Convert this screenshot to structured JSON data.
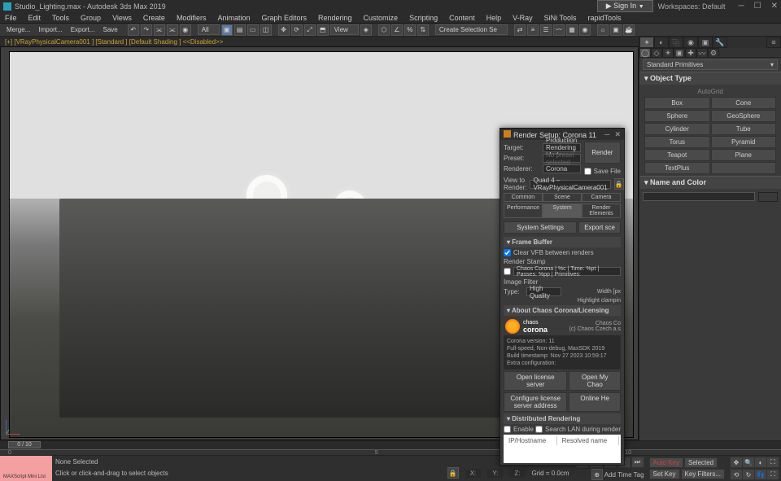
{
  "title": "Studio_Lighting.max - Autodesk 3ds Max 2019",
  "signin": "Sign In",
  "workspace_label": "Workspaces:",
  "workspace_value": "Default",
  "menus": [
    "File",
    "Edit",
    "Tools",
    "Group",
    "Views",
    "Create",
    "Modifiers",
    "Animation",
    "Graph Editors",
    "Rendering",
    "Customize",
    "Scripting",
    "Content",
    "Help",
    "V-Ray",
    "SiNi Tools",
    "rapidTools"
  ],
  "toolbar_labels": {
    "merge": "Merge...",
    "import": "Import...",
    "export": "Export...",
    "save": "Save",
    "all": "All",
    "view": "View",
    "create_sel": "Create Selection Se"
  },
  "viewport_label": "[+] [VRayPhysicalCamera001 ] [Standard ] [Default Shading ]  <<Disabled>>",
  "cmdpanel": {
    "category": "Standard Primitives",
    "objtype_head": "Object Type",
    "autogrid": "AutoGrid",
    "primitives": [
      "Box",
      "Cone",
      "Sphere",
      "GeoSphere",
      "Cylinder",
      "Tube",
      "Torus",
      "Pyramid",
      "Teapot",
      "Plane",
      "TextPlus",
      ""
    ],
    "namecolor_head": "Name and Color"
  },
  "dialog": {
    "title": "Render Setup: Corona 11",
    "target_lbl": "Target:",
    "target_val": "Production Rendering Mode",
    "preset_lbl": "Preset:",
    "preset_val": "No preset selected",
    "renderer_lbl": "Renderer:",
    "renderer_val": "Corona",
    "savefile_lbl": "Save File",
    "view_lbl": "View to Render:",
    "view_val": "Quad 4 – VRayPhysicalCamera001",
    "render_btn": "Render",
    "tabs1": [
      "Common",
      "Scene",
      "Camera"
    ],
    "tabs2": [
      "Performance",
      "System",
      "Render Elements"
    ],
    "sys_settings": "System Settings",
    "export_scn": "Export sce",
    "fb_head": "Frame Buffer",
    "clear_vfb": "Clear VFB between renders",
    "render_stamp": "Render Stamp",
    "stamp_val": "Chaos Corona | %c | Time: %pt | Passes: %pp | Primitives:",
    "img_filter": "Image Filter",
    "filter_type_lbl": "Type:",
    "filter_type_val": "High Quality",
    "width_lbl": "Width [px",
    "hl_clamp": "Highlight clampin",
    "about_head": "About Chaos Corona/Licensing",
    "chaos": "chaos",
    "corona": "corona",
    "chaos_co": "Chaos Co",
    "czech": "(c) Chaos Czech a.s",
    "info_lines": [
      "Corona version: 11",
      "Full-speed, Non-debug, MaxSDK 2019",
      "Build timestamp: Nov 27 2023 10:59:17",
      "Extra configuration:"
    ],
    "open_lic": "Open license server",
    "open_chaos": "Open My Chao",
    "conf_lic": "Configure license server address",
    "online_h": "Online He",
    "dist_head": "Distributed Rendering",
    "enable": "Enable",
    "search_lan": "Search LAN during render",
    "th_ip": "IP/Hostname",
    "th_res": "Resolved name"
  },
  "timeline": {
    "handle": "0 / 10",
    "ticks": [
      "0",
      "5",
      "10"
    ]
  },
  "status": {
    "mx": "MAXScript Mini List",
    "none": "None Selected",
    "hint": "Click or click-and-drag to select objects",
    "coords": {
      "x": "X:",
      "y": "Y:",
      "z": "Z:"
    },
    "grid": "Grid = 0.0cm",
    "addtime": "Add Time Tag",
    "autokey": "Auto Key",
    "setkey": "Set Key",
    "selected": "Selected",
    "keyfilters": "Key Filters..."
  }
}
